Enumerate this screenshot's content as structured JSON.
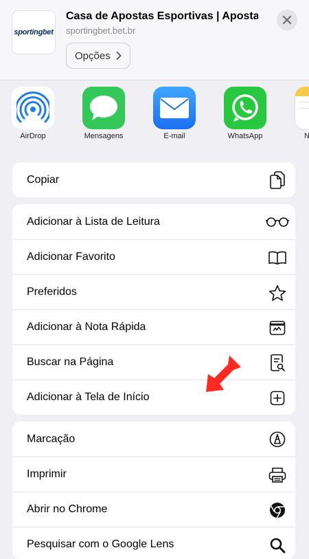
{
  "header": {
    "thumb_logo": "sportingbet",
    "title": "Casa de Apostas Esportivas | Aposta...",
    "domain": "sportingbet.bet.br",
    "options_label": "Opções"
  },
  "apps": [
    {
      "label": "AirDrop",
      "icon": "airdrop-icon"
    },
    {
      "label": "Mensagens",
      "icon": "messages-icon"
    },
    {
      "label": "E-mail",
      "icon": "mail-icon"
    },
    {
      "label": "WhatsApp",
      "icon": "whatsapp-icon"
    },
    {
      "label": "N",
      "icon": "notes-icon"
    }
  ],
  "group1": [
    {
      "label": "Copiar",
      "icon": "copy-icon"
    }
  ],
  "group2": [
    {
      "label": "Adicionar à Lista de Leitura",
      "icon": "glasses-icon"
    },
    {
      "label": "Adicionar Favorito",
      "icon": "book-icon"
    },
    {
      "label": "Preferidos",
      "icon": "star-icon"
    },
    {
      "label": "Adicionar à Nota Rápida",
      "icon": "quick-note-icon"
    },
    {
      "label": "Buscar na Página",
      "icon": "find-in-page-icon"
    },
    {
      "label": "Adicionar à Tela de Início",
      "icon": "add-square-icon"
    }
  ],
  "group3": [
    {
      "label": "Marcação",
      "icon": "markup-icon"
    },
    {
      "label": "Imprimir",
      "icon": "printer-icon"
    },
    {
      "label": "Abrir no Chrome",
      "icon": "chrome-icon"
    },
    {
      "label": "Pesquisar com o Google Lens",
      "icon": "search-icon"
    }
  ],
  "colors": {
    "background": "#efeff4",
    "annotation_arrow": "#ff2a1f",
    "messages_green": "#34c759",
    "mail_blue": "#1a8cff",
    "whatsapp_green": "#28c840",
    "airdrop_blue": "#1c7cf4"
  }
}
